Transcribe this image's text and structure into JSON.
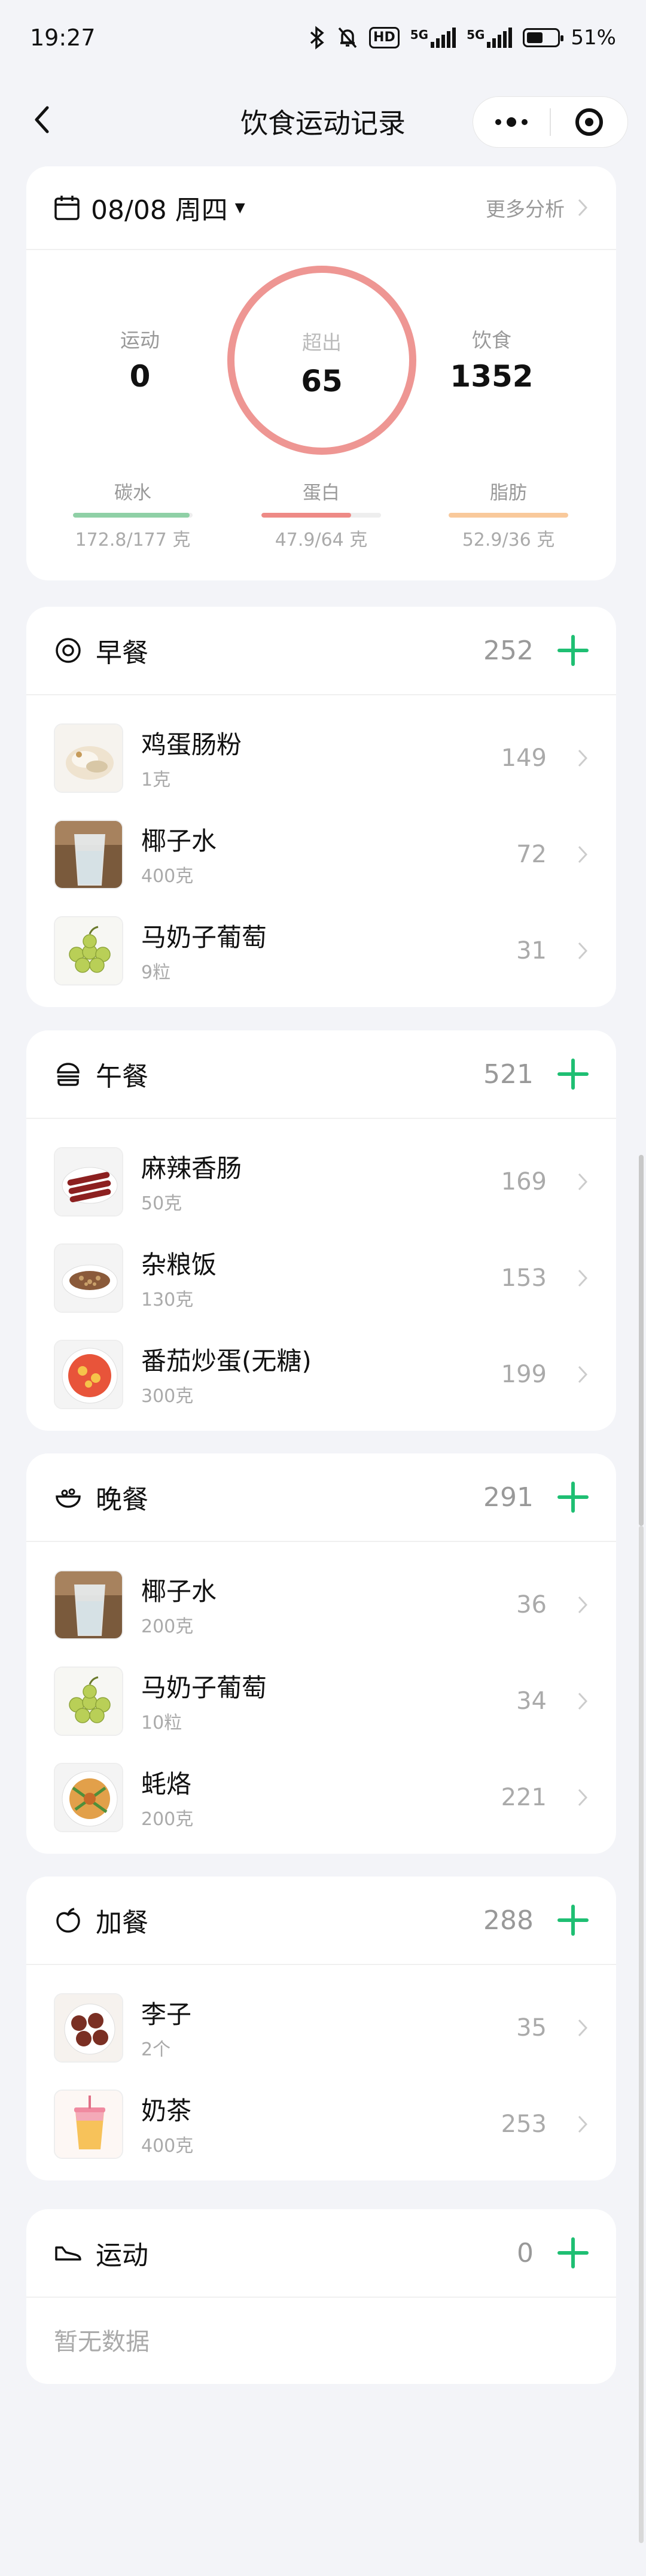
{
  "status_bar": {
    "time": "19:27",
    "hd_label": "HD",
    "net1_label": "5G",
    "net2_label": "5G",
    "battery_percent": "51%"
  },
  "nav": {
    "title": "饮食运动记录"
  },
  "summary": {
    "date": "08/08 周四",
    "more_label": "更多分析",
    "exercise_label": "运动",
    "exercise_value": "0",
    "exceed_label": "超出",
    "exceed_value": "65",
    "diet_label": "饮食",
    "diet_value": "1352",
    "macros": [
      {
        "label": "碳水",
        "nums": "172.8/177 克",
        "color": "#8fd0a6",
        "fraction": 0.976
      },
      {
        "label": "蛋白",
        "nums": "47.9/64 克",
        "color": "#ee8a86",
        "fraction": 0.75
      },
      {
        "label": "脂肪",
        "nums": "52.9/36 克",
        "color": "#f9c99b",
        "fraction": 1.0
      }
    ]
  },
  "meals": [
    {
      "title": "早餐",
      "total": "252",
      "icon": "egg-icon",
      "items": [
        {
          "name": "鸡蛋肠粉",
          "amount": "1克",
          "cal": "149",
          "thumb": "rice-roll"
        },
        {
          "name": "椰子水",
          "amount": "400克",
          "cal": "72",
          "thumb": "water"
        },
        {
          "name": "马奶子葡萄",
          "amount": "9粒",
          "cal": "31",
          "thumb": "grapes"
        }
      ]
    },
    {
      "title": "午餐",
      "total": "521",
      "icon": "burger-icon",
      "items": [
        {
          "name": "麻辣香肠",
          "amount": "50克",
          "cal": "169",
          "thumb": "sausage"
        },
        {
          "name": "杂粮饭",
          "amount": "130克",
          "cal": "153",
          "thumb": "grain-rice"
        },
        {
          "name": "番茄炒蛋(无糖)",
          "amount": "300克",
          "cal": "199",
          "thumb": "tomato-egg"
        }
      ]
    },
    {
      "title": "晚餐",
      "total": "291",
      "icon": "bowl-icon",
      "items": [
        {
          "name": "椰子水",
          "amount": "200克",
          "cal": "36",
          "thumb": "water"
        },
        {
          "name": "马奶子葡萄",
          "amount": "10粒",
          "cal": "34",
          "thumb": "grapes"
        },
        {
          "name": "蚝烙",
          "amount": "200克",
          "cal": "221",
          "thumb": "oyster-omelette"
        }
      ]
    },
    {
      "title": "加餐",
      "total": "288",
      "icon": "apple-icon",
      "items": [
        {
          "name": "李子",
          "amount": "2个",
          "cal": "35",
          "thumb": "plum"
        },
        {
          "name": "奶茶",
          "amount": "400克",
          "cal": "253",
          "thumb": "milk-tea"
        }
      ]
    }
  ],
  "exercise": {
    "title": "运动",
    "total": "0",
    "empty_label": "暂无数据"
  }
}
